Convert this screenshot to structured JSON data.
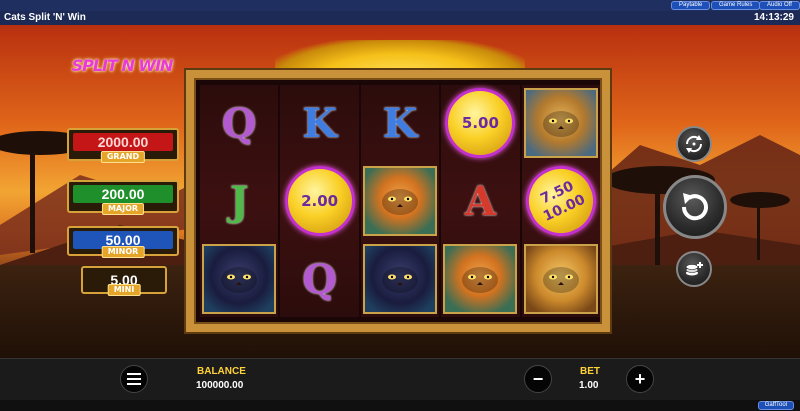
{
  "top_bar": {
    "buttons": [
      "Paytable",
      "Game Rules",
      "Audio Off"
    ]
  },
  "title_bar": {
    "title": "Cats Split 'N' Win",
    "clock": "14:13:29"
  },
  "logo": {
    "text": "SPLIT N WIN"
  },
  "jackpots": [
    {
      "value": "2000.00",
      "label": "GRAND",
      "color": "#c41616",
      "text_color": "#ffffff"
    },
    {
      "value": "200.00",
      "label": "MAJOR",
      "color": "#1f8f2b",
      "text_color": "#ffffff"
    },
    {
      "value": "50.00",
      "label": "MINOR",
      "color": "#1f55b8",
      "text_color": "#ffffff"
    },
    {
      "value": "5.00",
      "label": "MINI",
      "color": "#2a1a08",
      "text_color": "#ffffff"
    }
  ],
  "reels": [
    [
      {
        "kind": "letter",
        "value": "Q"
      },
      {
        "kind": "letter",
        "value": "J"
      },
      {
        "kind": "animal",
        "animal": "panther",
        "name": "Panther"
      }
    ],
    [
      {
        "kind": "letter",
        "value": "K"
      },
      {
        "kind": "coin",
        "values": [
          "2.00"
        ]
      },
      {
        "kind": "letter",
        "value": "Q"
      }
    ],
    [
      {
        "kind": "letter",
        "value": "K"
      },
      {
        "kind": "animal",
        "animal": "tiger",
        "name": "Tiger"
      },
      {
        "kind": "animal",
        "animal": "panther",
        "name": "Panther"
      }
    ],
    [
      {
        "kind": "coin",
        "values": [
          "5.00"
        ]
      },
      {
        "kind": "letter",
        "value": "A"
      },
      {
        "kind": "animal",
        "animal": "tiger",
        "name": "Tiger"
      }
    ],
    [
      {
        "kind": "animal",
        "animal": "leopard",
        "name": "Leopards"
      },
      {
        "kind": "coin",
        "values": [
          "7.50",
          "10.00"
        ],
        "split": true
      },
      {
        "kind": "animal",
        "animal": "lion",
        "name": "Lion"
      }
    ]
  ],
  "side_buttons": {
    "autoplay_icon": "autoplay-icon",
    "spin_icon": "spin-icon",
    "coins_icon": "coins-plus-icon"
  },
  "bottom_bar": {
    "menu_icon": "menu-icon",
    "balance_label": "BALANCE",
    "balance_value": "100000.00",
    "bet_label": "BET",
    "bet_value": "1.00",
    "minus_label": "−",
    "plus_label": "+"
  },
  "status": {
    "gaff_tool": "GaffTool"
  },
  "colors": {
    "frame_gold": "#c8913a",
    "coin_border": "#c430d0",
    "label_yellow": "#ffd23a"
  }
}
